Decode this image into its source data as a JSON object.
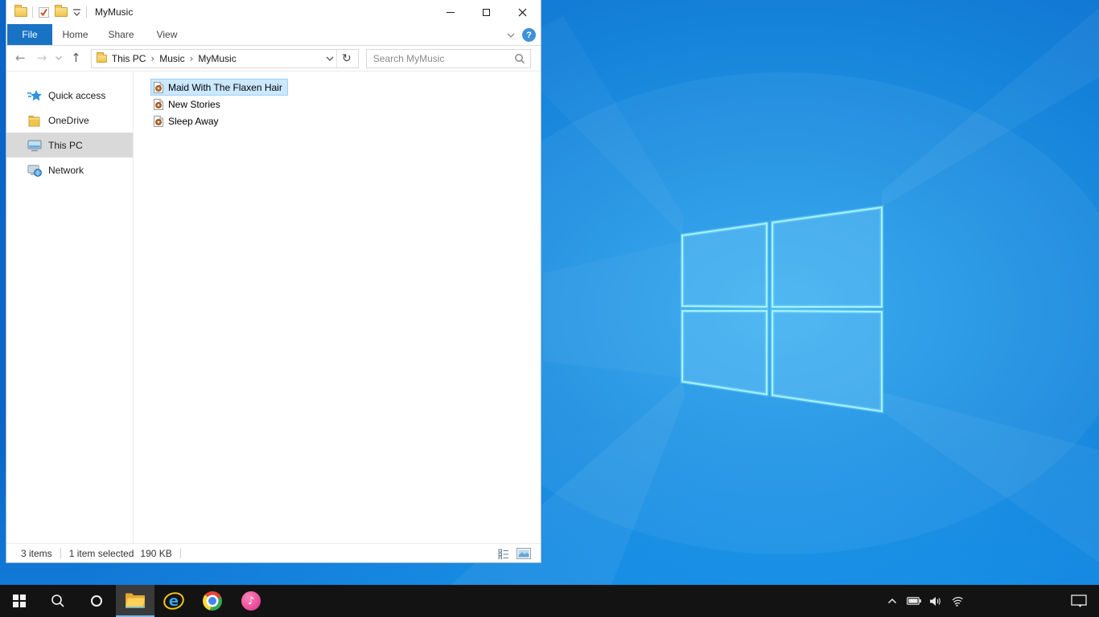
{
  "window": {
    "title": "MyMusic"
  },
  "ribbon": {
    "tabs": [
      {
        "label": "File",
        "active": true
      },
      {
        "label": "Home",
        "active": false
      },
      {
        "label": "Share",
        "active": false
      },
      {
        "label": "View",
        "active": false
      }
    ]
  },
  "navbar": {
    "breadcrumb": [
      "This PC",
      "Music",
      "MyMusic"
    ],
    "search_placeholder": "Search MyMusic"
  },
  "sidebar": {
    "items": [
      {
        "label": "Quick access",
        "icon": "quick-access-star-icon",
        "selected": false
      },
      {
        "label": "OneDrive",
        "icon": "onedrive-folder-icon",
        "selected": false
      },
      {
        "label": "This PC",
        "icon": "this-pc-icon",
        "selected": true
      },
      {
        "label": "Network",
        "icon": "network-icon",
        "selected": false
      }
    ]
  },
  "files": {
    "items": [
      {
        "name": "Maid With The Flaxen Hair",
        "icon": "music-file-icon",
        "selected": true
      },
      {
        "name": "New Stories",
        "icon": "music-file-icon",
        "selected": false
      },
      {
        "name": "Sleep Away",
        "icon": "music-file-icon",
        "selected": false
      }
    ]
  },
  "statusbar": {
    "items_count": "3 items",
    "selection": "1 item selected",
    "selection_size": "190 KB"
  },
  "taskbar": {
    "buttons": [
      "start",
      "search",
      "cortana",
      "file-explorer",
      "internet-explorer",
      "chrome",
      "itunes"
    ],
    "active_button": "file-explorer",
    "tray": [
      "hidden-icons-chevron",
      "battery",
      "volume",
      "wifi"
    ],
    "action_center": "action-center"
  },
  "icons": {
    "back": "←",
    "forward": "→",
    "up": "↑",
    "refresh": "↻",
    "crumb_separator": "›",
    "help": "?",
    "music_note": "♪"
  },
  "colors": {
    "file_tab_blue": "#1873c5",
    "selection_fill": "#cce8ff",
    "selection_border": "#99d1ff",
    "sidebar_selected": "#d9d9d9",
    "taskbar": "#131313",
    "taskbar_underline": "#76b9ed",
    "wallpaper_mid": "#1583da",
    "logo_edge": "#a8f2fc"
  }
}
